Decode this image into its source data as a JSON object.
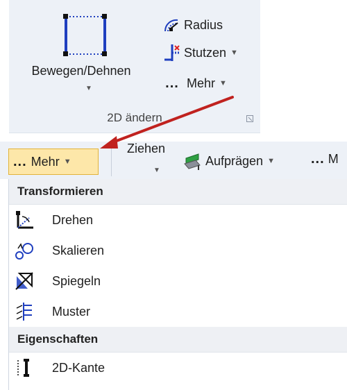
{
  "ribbon": {
    "move_stretch": {
      "label": "Bewegen/Dehnen",
      "icon": "move-stretch-icon"
    },
    "radius": {
      "label": "Radius",
      "icon": "radius-icon"
    },
    "stutzen": {
      "label": "Stutzen",
      "icon": "trim-icon"
    },
    "mehr": {
      "dots": "...",
      "label": "Mehr",
      "icon": "more-dots-icon"
    },
    "group_label": "2D ändern"
  },
  "row2": {
    "mehr": {
      "dots": "...",
      "label": "Mehr"
    },
    "ziehen": {
      "label": "Ziehen"
    },
    "aufpraegen": {
      "label": "Aufprägen",
      "icon": "imprint-icon"
    },
    "tail": {
      "dots": "...",
      "label": "M"
    }
  },
  "menu": {
    "sections": [
      {
        "header": "Transformieren",
        "items": [
          {
            "label": "Drehen",
            "icon": "rotate-icon"
          },
          {
            "label": "Skalieren",
            "icon": "scale-icon"
          },
          {
            "label": "Spiegeln",
            "icon": "mirror-icon"
          },
          {
            "label": "Muster",
            "icon": "pattern-icon"
          }
        ]
      },
      {
        "header": "Eigenschaften",
        "items": [
          {
            "label": "2D-Kante",
            "icon": "edge-2d-icon"
          }
        ]
      }
    ]
  },
  "colors": {
    "ribbon_bg": "#edf1f7",
    "highlight": "#fde7a9",
    "highlight_border": "#e2b33a",
    "arrow": "#c0221f",
    "icon_blue": "#1f3fbf"
  }
}
